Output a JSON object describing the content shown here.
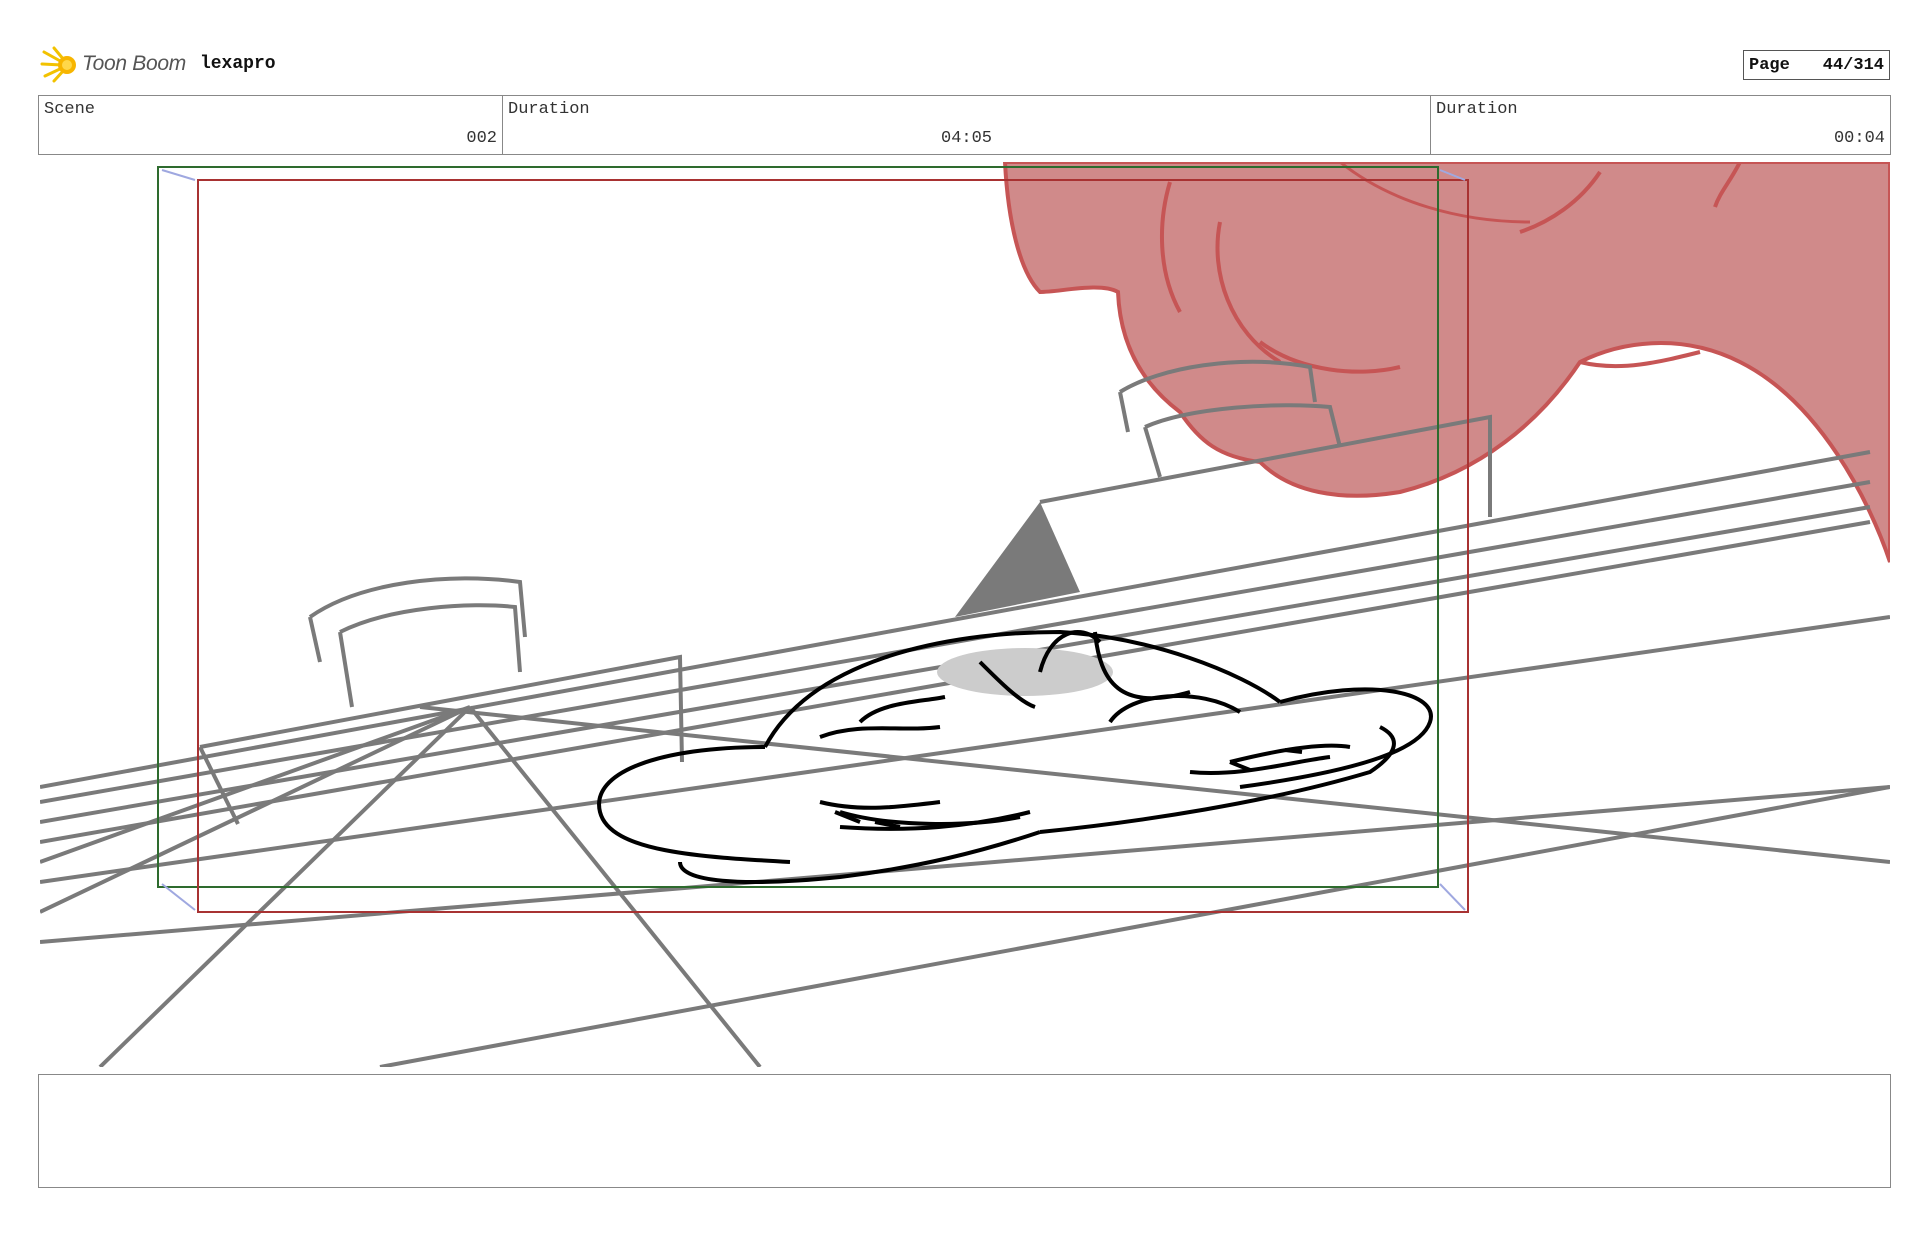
{
  "header": {
    "brand": "Toon Boom",
    "project": "lexapro",
    "page_label": "Page",
    "page_value": "44/314"
  },
  "info": {
    "scene_label": "Scene",
    "scene_value": "002",
    "duration_label": "Duration",
    "duration_value": "04:05",
    "panel_duration_label": "Duration",
    "panel_duration_value": "00:04"
  },
  "panel": {
    "safe_frame_color": "#2e6b2e",
    "camera_frame_color": "#a83232",
    "hand_color": "#d08a8a",
    "hand_outline_color": "#c65555",
    "line_color": "#7a7a7a",
    "character_color": "#000000"
  },
  "notes": {
    "text": ""
  }
}
